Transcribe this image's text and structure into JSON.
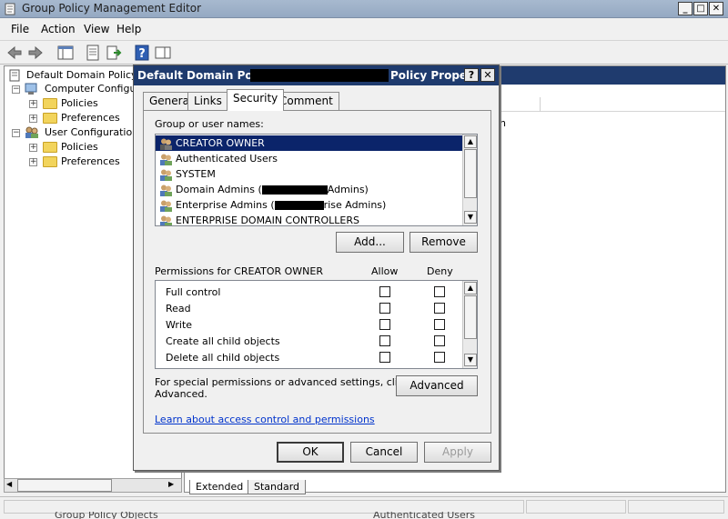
{
  "window": {
    "title": "Group Policy Management Editor",
    "min": "_",
    "max": "□",
    "close": "✕"
  },
  "menu": [
    "File",
    "Action",
    "View",
    "Help"
  ],
  "tree": {
    "root": "Default Domain Policy [L",
    "computer_config": "Computer Configura",
    "user_config": "User Configuration",
    "policies": "Policies",
    "preferences": "Preferences"
  },
  "bottom_tabs": [
    "Extended",
    "Standard"
  ],
  "dialog": {
    "title_prefix": "Default Domain Policy",
    "title_suffix": "Policy Prope...",
    "help": "?",
    "close": "✕",
    "tabs": [
      "General",
      "Links",
      "Security",
      "Comment"
    ],
    "active_tab": "Security",
    "group_label": "Group or user names:",
    "users": [
      "CREATOR OWNER",
      "Authenticated Users",
      "SYSTEM",
      "Domain Admins (",
      "Enterprise Admins (",
      "ENTERPRISE DOMAIN CONTROLLERS"
    ],
    "domain_admins_tail": "Admins)",
    "enterprise_admins_tail": "rise Admins)",
    "selected_user": "CREATOR OWNER",
    "add_button": "Add...",
    "remove_button": "Remove",
    "permissions_label": "Permissions for CREATOR OWNER",
    "allow_header": "Allow",
    "deny_header": "Deny",
    "permissions": [
      "Full control",
      "Read",
      "Write",
      "Create all child objects",
      "Delete all child objects"
    ],
    "special_text_1": "For special permissions or advanced settings, click",
    "special_text_2": "Advanced.",
    "advanced_button": "Advanced",
    "learn_link": "Learn about access control and permissions",
    "ok": "OK",
    "cancel": "Cancel",
    "apply": "Apply"
  },
  "right_pane_fragment": "n",
  "bottom_fragment_left": "Group Policy Objects",
  "bottom_fragment_right": "Authenticated Users"
}
